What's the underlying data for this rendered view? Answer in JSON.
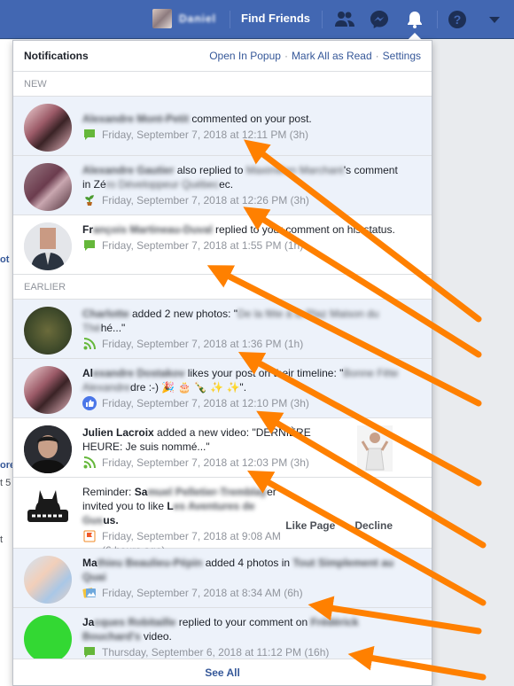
{
  "topbar": {
    "user_name": "Daniel",
    "find_friends": "Find Friends",
    "icons": [
      "friends-icon",
      "messenger-icon",
      "notifications-bell-icon",
      "help-icon",
      "account-menu-chevron-icon"
    ]
  },
  "left_fragments": [
    "ot",
    "ore",
    "t 5",
    "t"
  ],
  "panel": {
    "title": "Notifications",
    "links": {
      "open_popup": "Open In Popup",
      "separator": "·",
      "mark_all": "Mark All as Read",
      "settings": "Settings"
    },
    "sections": {
      "new": "NEW",
      "earlier": "EARLIER"
    },
    "see_all": "See All"
  },
  "notifications": {
    "n1": {
      "actor": "Alexandre Mont-Petit",
      "text": " commented on your post.",
      "time": "Friday, September 7, 2018 at 12:11 PM (3h)",
      "icon": "comment-icon"
    },
    "n2": {
      "actor": "Alexandre Gautier",
      "text1": " also replied to ",
      "redacted1": "Maximilien Marchant",
      "text2": "'s comment in Zé",
      "redacted2": "ro Développeur Québec",
      "text3": "ec.",
      "time": "Friday, September 7, 2018 at 12:26 PM (3h)",
      "icon": "plant-icon"
    },
    "n3": {
      "actor_visible": "Fr",
      "actor_redacted": "ançois Martineau-Duval",
      "text": " replied to your comment on his status.",
      "time": "Friday, September 7, 2018 at 1:55 PM (1h)",
      "icon": "comment-icon"
    },
    "n4": {
      "actor": "Charlotte",
      "text": " added 2 new photos: \"",
      "redacted": "De la fête à la Plaz Maison du Thé",
      "text2": "hé...\"",
      "time": "Friday, September 7, 2018 at 1:36 PM (1h)",
      "icon": "feed-icon"
    },
    "n5": {
      "actor_visible": "Al",
      "actor_redacted": "exandre Dostakov",
      "text": " likes your post on their timeline: \"",
      "redacted": "Bonne Fête Alexandre",
      "text2": "dre :-) 🎉 🎂 🍾 ✨ ✨\".",
      "time": "Friday, September 7, 2018 at 12:10 PM (3h)",
      "icon": "like-icon"
    },
    "n6": {
      "actor": "Julien Lacroix",
      "text": " added a new video: \"DERNIÈRE HEURE: Je suis nommé...\"",
      "time": "Friday, September 7, 2018 at 12:03 PM (3h)",
      "icon": "feed-icon"
    },
    "n7": {
      "prefix": "Reminder: ",
      "actor_visible": "Sa",
      "actor_redacted": "muel Pelletier-Tremblay",
      "text": "er invited you to like ",
      "page_visible": "L",
      "page_redacted": "es Aventures de Gus",
      "text2": "us.",
      "time": "Friday, September 7, 2018 at 9:08 AM (6 hours ago)",
      "icon": "flag-icon",
      "like_page": "Like Page",
      "decline": "Decline"
    },
    "n8": {
      "actor_visible": "Ma",
      "actor_redacted": "thieu Beaulieu-Pépin",
      "text": " added 4 photos in ",
      "redacted": "Tout Simplement au Quai",
      "time": "Friday, September 7, 2018 at 8:34 AM (6h)",
      "icon": "photos-icon"
    },
    "n9": {
      "actor_visible": "Ja",
      "actor_redacted": "cques Robitaille",
      "text": " replied to your comment on ",
      "redacted": "Frédérick Bouchard's",
      "text2": " video.",
      "time": "Thursday, September 6, 2018 at 11:12 PM (16h)",
      "icon": "comment-icon"
    }
  },
  "colors": {
    "topbar": "#4267b2",
    "unread": "#edf2fa",
    "link": "#365899",
    "arrow": "#ff8000"
  }
}
